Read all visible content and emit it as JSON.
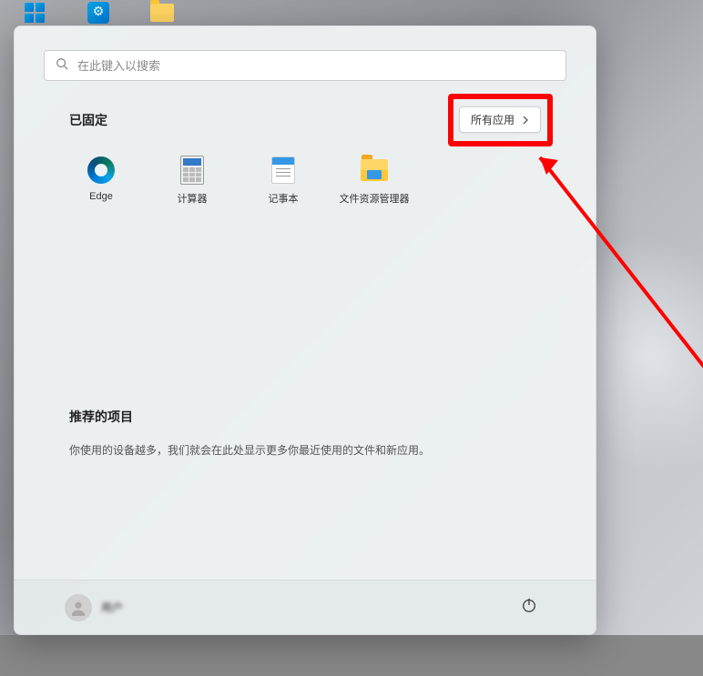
{
  "search": {
    "placeholder": "在此键入以搜索"
  },
  "sections": {
    "pinned_title": "已固定",
    "all_apps_label": "所有应用",
    "recommended_title": "推荐的项目",
    "recommended_text": "你使用的设备越多，我们就会在此处显示更多你最近使用的文件和新应用。"
  },
  "pinned": {
    "items": [
      {
        "label": "Edge"
      },
      {
        "label": "计算器"
      },
      {
        "label": "记事本"
      },
      {
        "label": "文件资源管理器"
      }
    ]
  },
  "user": {
    "name": "用户"
  }
}
